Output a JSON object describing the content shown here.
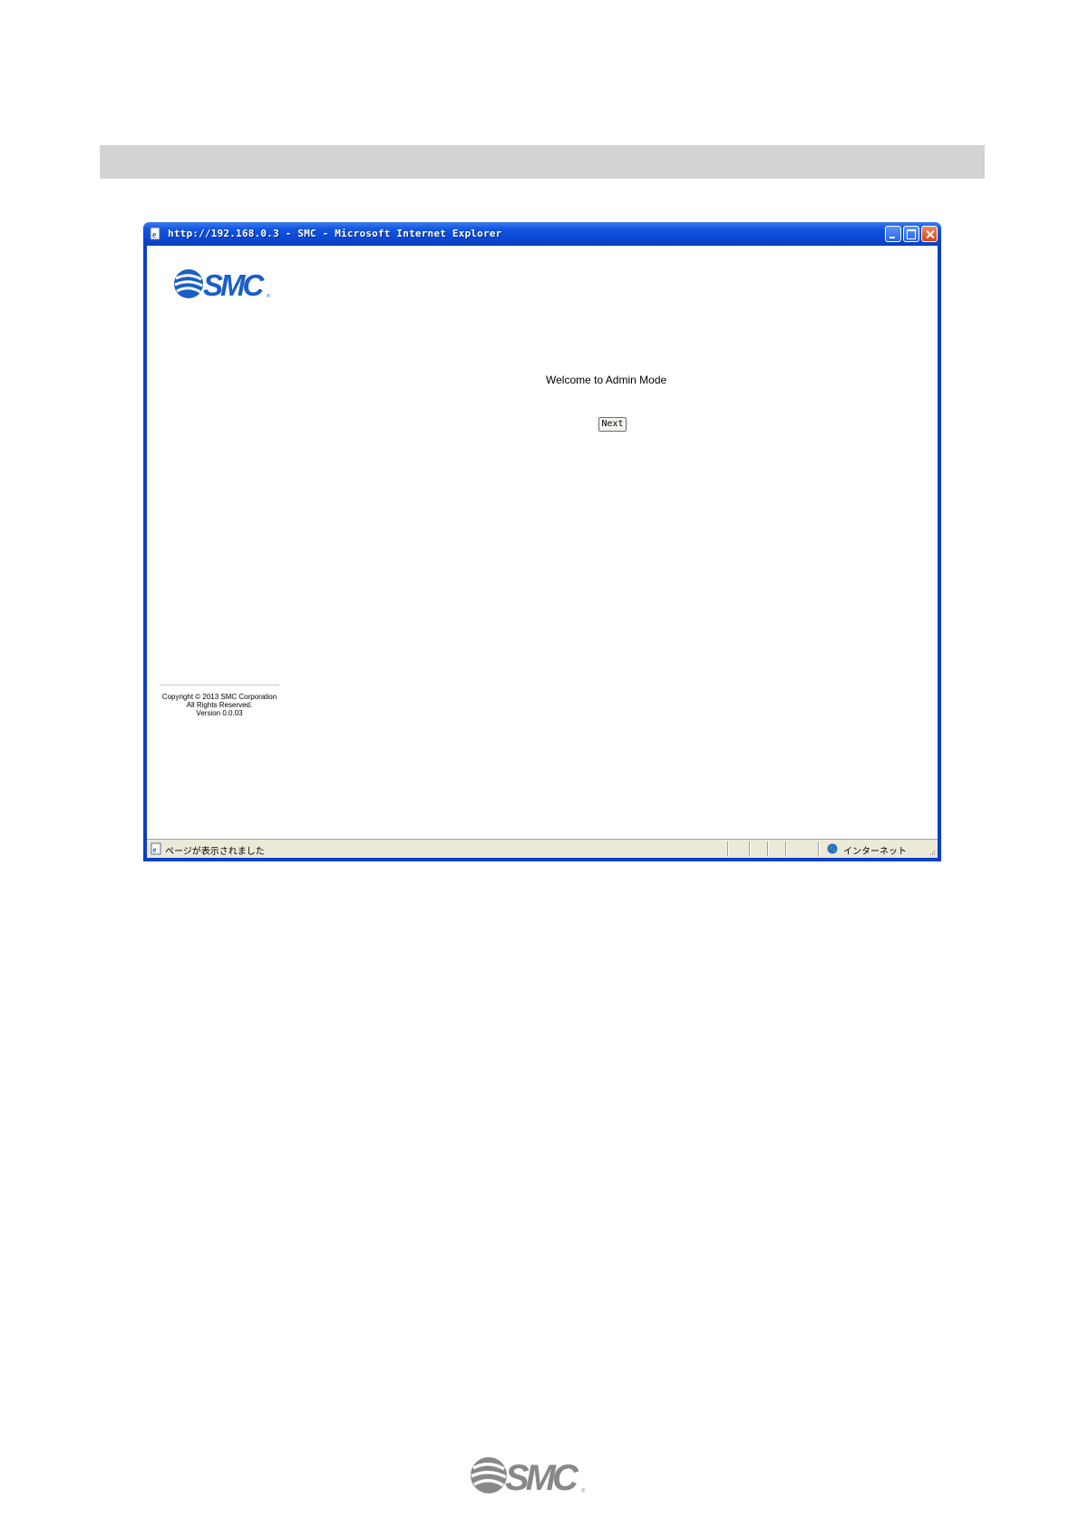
{
  "window": {
    "title": "http://192.168.0.3 - SMC - Microsoft Internet Explorer"
  },
  "page": {
    "logo_text": "SMC",
    "welcome_text": "Welcome to Admin Mode",
    "next_label": "Next",
    "footer": {
      "copyright": "Copyright © 2013 SMC Corporation",
      "rights": "All Rights Reserved.",
      "version": "Version 0.0.03"
    }
  },
  "statusbar": {
    "status_text": "ページが表示されました",
    "zone_text": "インターネット"
  },
  "document": {
    "footer_logo_text": "SMC"
  },
  "colors": {
    "titlebar": "#1456e0",
    "logo_blue": "#1a5fc8",
    "logo_gray": "#888888",
    "header_bar": "#d3d3d3"
  }
}
